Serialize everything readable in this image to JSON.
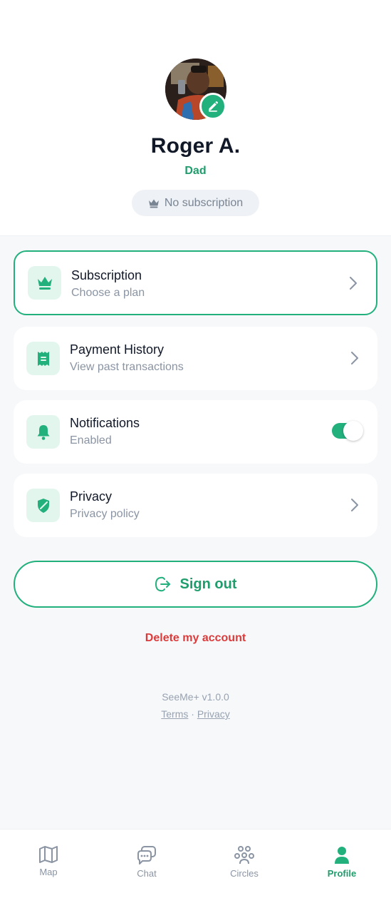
{
  "profile": {
    "name": "Roger A.",
    "role": "Dad",
    "subscription_status": "No subscription"
  },
  "menu": [
    {
      "title": "Subscription",
      "subtitle": "Choose a plan",
      "icon": "crown-icon",
      "active": true
    },
    {
      "title": "Payment History",
      "subtitle": "View past transactions",
      "icon": "receipt-icon"
    },
    {
      "title": "Notifications",
      "subtitle": "Enabled",
      "icon": "bell-icon",
      "toggle_on": true
    },
    {
      "title": "Privacy",
      "subtitle": "Privacy policy",
      "icon": "shield-icon"
    }
  ],
  "actions": {
    "sign_out": "Sign out",
    "delete_account": "Delete my account"
  },
  "footer": {
    "version": "SeeMe+ v1.0.0",
    "terms": "Terms",
    "separator": " · ",
    "privacy": "Privacy"
  },
  "tabs": [
    {
      "label": "Map",
      "icon": "map-icon"
    },
    {
      "label": "Chat",
      "icon": "chat-icon"
    },
    {
      "label": "Circles",
      "icon": "circles-icon"
    },
    {
      "label": "Profile",
      "icon": "profile-icon",
      "active": true
    }
  ],
  "colors": {
    "accent": "#22b07d",
    "accent_text": "#1f9d6c",
    "danger": "#dc3b3b",
    "background": "#f6f8fa"
  }
}
